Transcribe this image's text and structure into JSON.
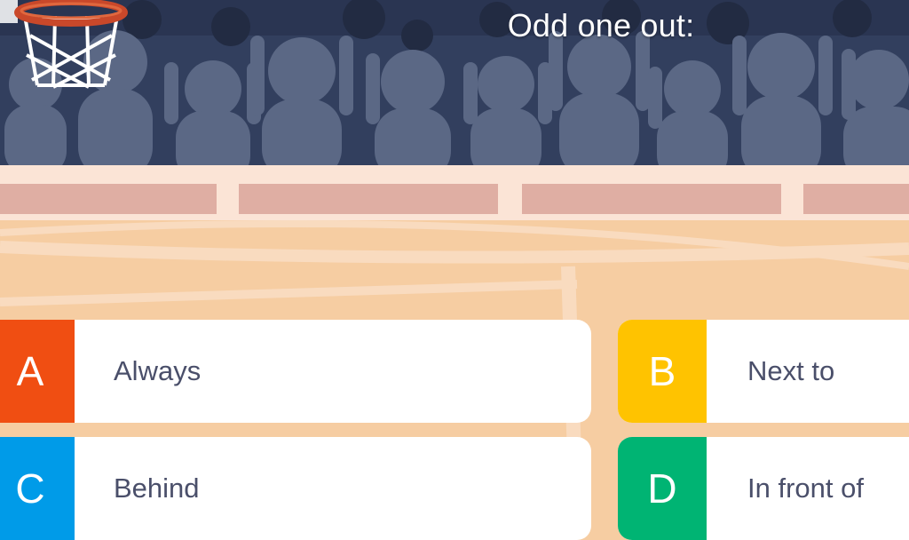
{
  "question": {
    "text": "Odd one out:"
  },
  "answers": [
    {
      "letter": "A",
      "text": "Always",
      "color": "#f04e12"
    },
    {
      "letter": "B",
      "text": "Next to",
      "color": "#ffc300"
    },
    {
      "letter": "C",
      "text": "Behind",
      "color": "#009be8"
    },
    {
      "letter": "D",
      "text": "In front of",
      "color": "#00b473"
    }
  ],
  "colors": {
    "crowd_bg": "#323f5e",
    "crowd_figure": "#5b6885",
    "court": "#f6cda2",
    "stripe": "#dfaea3"
  }
}
